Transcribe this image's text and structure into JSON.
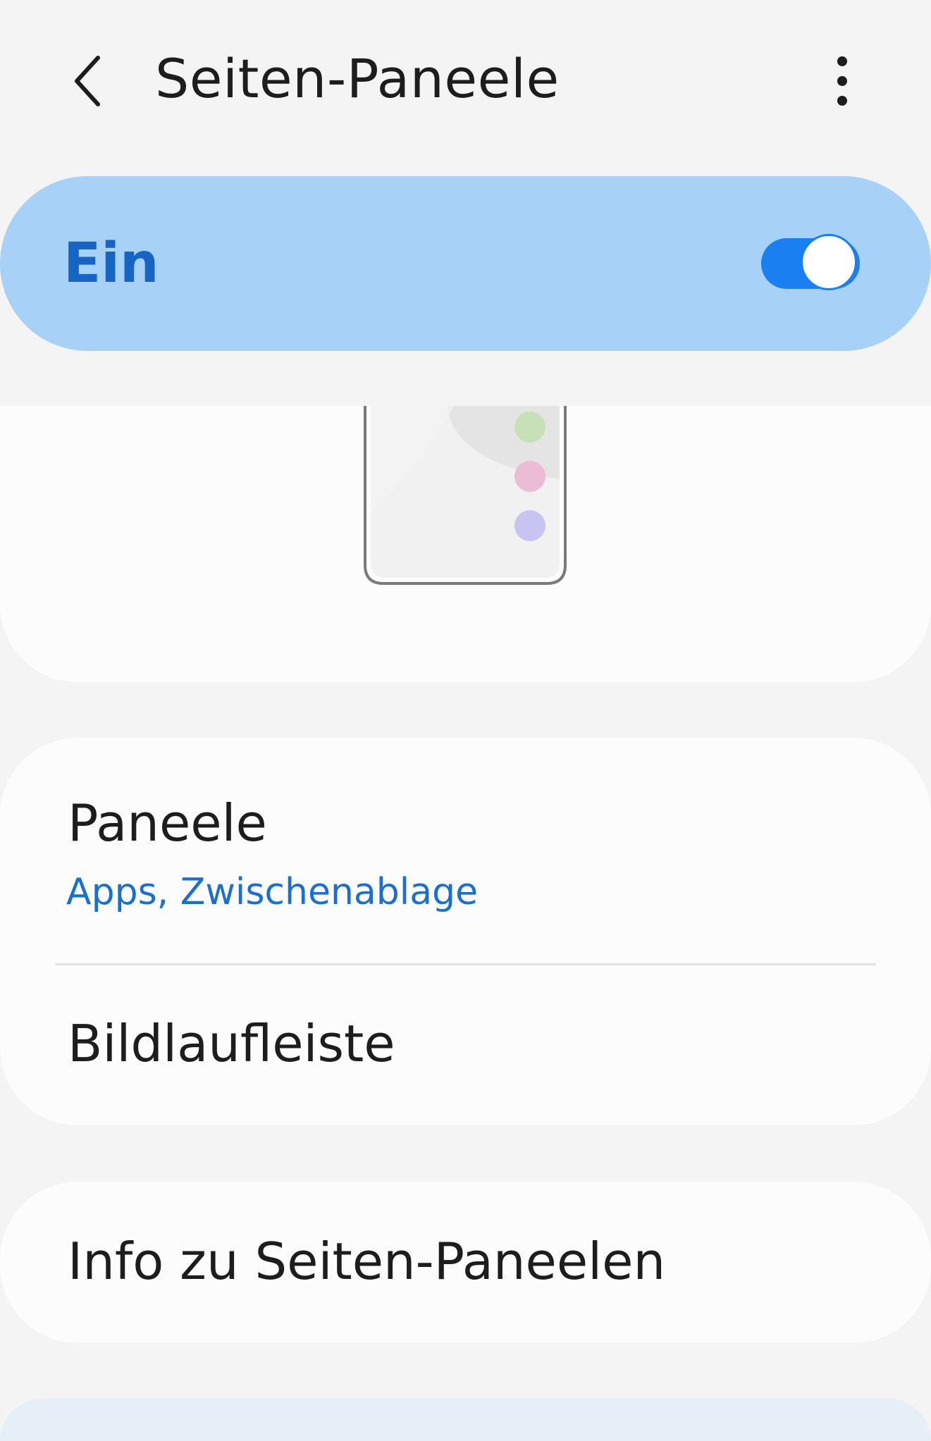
{
  "header": {
    "title": "Seiten-Paneele",
    "back_icon": "chevron-left-icon",
    "more_icon": "more-vertical-icon"
  },
  "master_switch": {
    "label": "Ein",
    "checked": true,
    "background": "#a8d1f8",
    "accent": "#1a7ff0"
  },
  "preview": {
    "dot_colors": [
      "#c8e0b8",
      "#ecbcd4",
      "#c8c4f2"
    ]
  },
  "settings": {
    "paneele": {
      "title": "Paneele",
      "subtitle": "Apps, Zwischenablage"
    },
    "bildlaufleiste": {
      "title": "Bildlaufleiste"
    }
  },
  "info": {
    "title": "Info zu Seiten-Paneelen"
  }
}
